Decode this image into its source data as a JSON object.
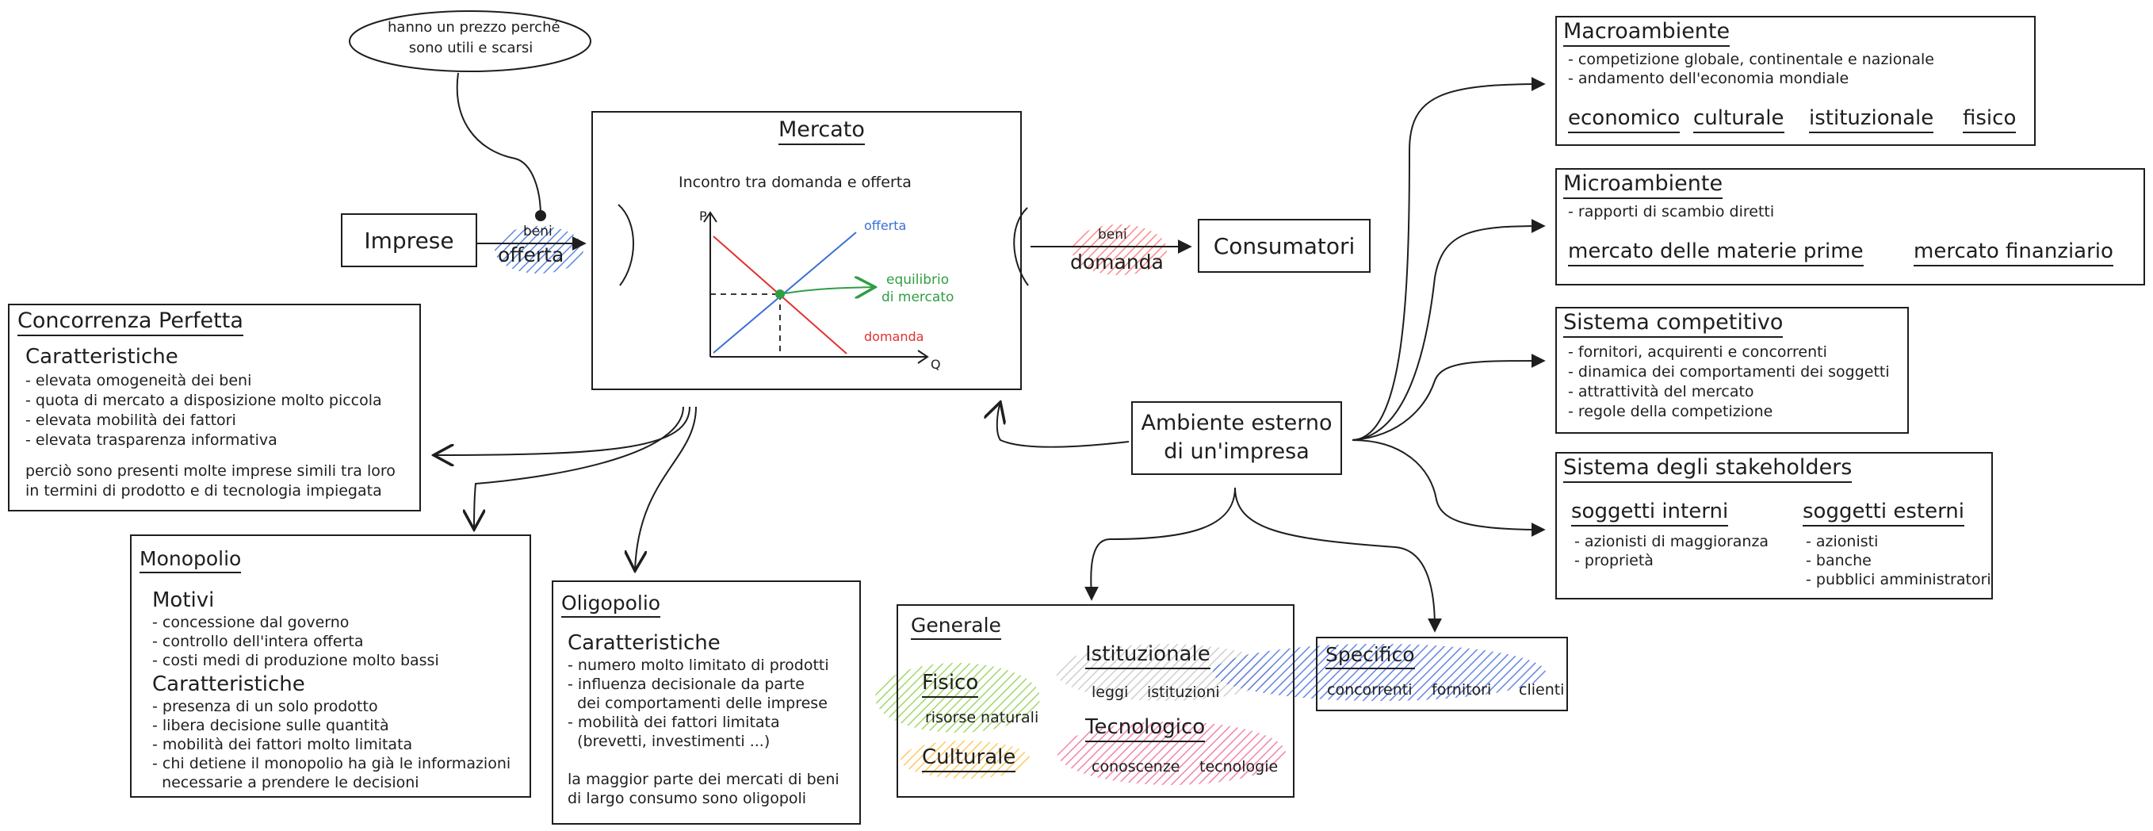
{
  "note": {
    "line1": "hanno un prezzo perché",
    "line2": "sono utili e scarsi"
  },
  "imprese": "Imprese",
  "consumatori": "Consumatori",
  "offerta_flow": {
    "small": "beni",
    "big": "offerta"
  },
  "domanda_flow": {
    "small": "beni",
    "big": "domanda"
  },
  "mercato": {
    "title": "Mercato",
    "subtitle": "Incontro tra domanda e offerta",
    "graph": {
      "y_axis": "P",
      "x_axis": "Q",
      "supply_label": "offerta",
      "demand_label": "domanda",
      "eq_line1": "equilibrio",
      "eq_line2": "di mercato"
    }
  },
  "colors": {
    "blue": "#3b6fd6",
    "red": "#e03131",
    "green": "#2f9e44",
    "ink": "#1e1e1e",
    "yellow": "#f2a800",
    "pink": "#e64980",
    "gray": "#a0a0a0"
  },
  "concorrenza": {
    "title": "Concorrenza Perfetta",
    "heading": "Caratteristiche",
    "items": [
      "- elevata omogeneità dei beni",
      "- quota di mercato a disposizione molto piccola",
      "- elevata mobilità dei fattori",
      "- elevata trasparenza informativa"
    ],
    "note_line1": "perciò sono presenti molte imprese simili tra loro",
    "note_line2": "in termini di prodotto e di tecnologia impiegata"
  },
  "monopolio": {
    "title": "Monopolio",
    "motivi_heading": "Motivi",
    "motivi": [
      "- concessione dal governo",
      "- controllo dell'intera offerta",
      "- costi medi di produzione molto bassi"
    ],
    "car_heading": "Caratteristiche",
    "caratteristiche": [
      "- presenza di un solo prodotto",
      "- libera decisione sulle quantità",
      "- mobilità dei fattori molto limitata",
      "- chi detiene il monopolio ha già le informazioni",
      "  necessarie a prendere le decisioni"
    ]
  },
  "oligopolio": {
    "title": "Oligopolio",
    "heading": "Caratteristiche",
    "items": [
      "- numero molto limitato di prodotti",
      "- influenza decisionale da parte",
      "  dei comportamenti delle imprese",
      "- mobilità dei fattori limitata",
      "  (brevetti, investimenti ...)"
    ],
    "note_line1": "la maggior parte dei mercati di beni",
    "note_line2": "di largo consumo sono oligopoli"
  },
  "ambiente": {
    "line1": "Ambiente esterno",
    "line2": "di un'impresa"
  },
  "generale": {
    "title": "Generale",
    "fisico": {
      "title": "Fisico",
      "item": "risorse naturali"
    },
    "culturale": {
      "title": "Culturale"
    },
    "istituzionale": {
      "title": "Istituzionale",
      "items": [
        "leggi",
        "istituzioni"
      ]
    },
    "tecnologico": {
      "title": "Tecnologico",
      "items": [
        "conoscenze",
        "tecnologie"
      ]
    }
  },
  "specifico": {
    "title": "Specifico",
    "items": [
      "concorrenti",
      "fornitori",
      "clienti"
    ]
  },
  "macro": {
    "title": "Macroambiente",
    "items": [
      "- competizione globale, continentale e nazionale",
      "- andamento dell'economia mondiale"
    ],
    "tags": [
      "economico",
      "culturale",
      "istituzionale",
      "fisico"
    ]
  },
  "micro": {
    "title": "Microambiente",
    "items": [
      "- rapporti di scambio diretti"
    ],
    "tags": [
      "mercato delle materie prime",
      "mercato finanziario"
    ]
  },
  "competitivo": {
    "title": "Sistema competitivo",
    "items": [
      "- fornitori, acquirenti e concorrenti",
      "- dinamica dei comportamenti dei soggetti",
      "- attrattività del mercato",
      "- regole della competizione"
    ]
  },
  "stakeholders": {
    "title": "Sistema degli stakeholders",
    "interni": {
      "title": "soggetti interni",
      "items": [
        "- azionisti di maggioranza",
        "- proprietà"
      ]
    },
    "esterni": {
      "title": "soggetti esterni",
      "items": [
        "- azionisti",
        "- banche",
        "- pubblici amministratori"
      ]
    }
  }
}
